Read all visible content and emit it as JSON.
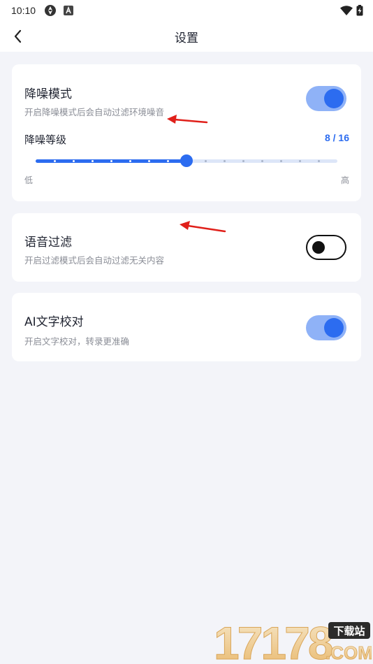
{
  "status_bar": {
    "time": "10:10",
    "left_icons": [
      "app-sync-icon",
      "accessibility-a-icon"
    ],
    "right_icons": [
      "wifi-icon",
      "battery-charging-icon"
    ]
  },
  "header": {
    "title": "设置",
    "back_icon": "chevron-left-icon"
  },
  "colors": {
    "accent": "#2c6cf0",
    "toggle_track_on": "#8fb2f7",
    "page_background": "#f3f4f9",
    "annotation_arrow": "#e0201a"
  },
  "settings": {
    "noise_reduction": {
      "title": "降噪模式",
      "description": "开启降噪模式后会自动过滤环境噪音",
      "enabled": true,
      "level_label": "降噪等级",
      "level_value": 8,
      "level_max": 16,
      "level_display": "8 / 16",
      "range_min_label": "低",
      "range_max_label": "高"
    },
    "voice_filter": {
      "title": "语音过滤",
      "description": "开启过滤模式后会自动过滤无关内容",
      "enabled": false
    },
    "ai_proofreading": {
      "title": "AI文字校对",
      "description": "开启文字校对，转录更准确",
      "enabled": true
    }
  },
  "watermark": {
    "logo_text": "17178",
    "badge_text": "下载站",
    "domain_text": ".COM"
  }
}
